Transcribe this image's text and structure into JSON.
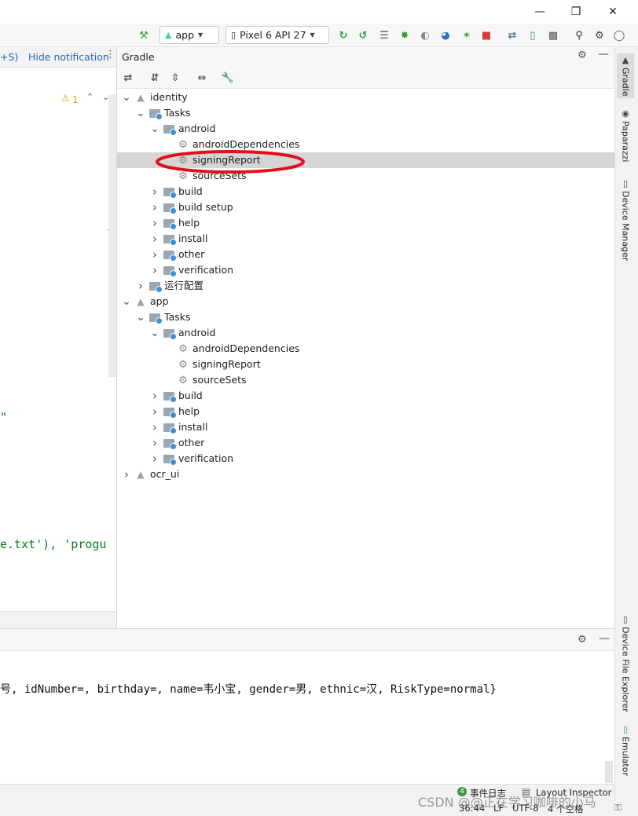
{
  "toolbar": {
    "run_config": "app",
    "device": "Pixel 6 API 27"
  },
  "editor": {
    "shortcut_fragment": "+S)",
    "hide_notification": "Hide notification",
    "warning_count": "1",
    "code_line_1": "\"",
    "code_line_2": "e.txt'), 'progu"
  },
  "gradle": {
    "title": "Gradle",
    "tree": [
      {
        "label": "identity",
        "icon": "elephant-icon",
        "expanded": true
      },
      {
        "label": "Tasks",
        "icon": "folder-icon",
        "expanded": true
      },
      {
        "label": "android",
        "icon": "folder-icon",
        "expanded": true
      },
      {
        "label": "androidDependencies",
        "icon": "gear-icon"
      },
      {
        "label": "signingReport",
        "icon": "gear-icon",
        "selected": true
      },
      {
        "label": "sourceSets",
        "icon": "gear-icon"
      },
      {
        "label": "build",
        "icon": "folder-icon",
        "expanded": false
      },
      {
        "label": "build setup",
        "icon": "folder-icon",
        "expanded": false
      },
      {
        "label": "help",
        "icon": "folder-icon",
        "expanded": false
      },
      {
        "label": "install",
        "icon": "folder-icon",
        "expanded": false
      },
      {
        "label": "other",
        "icon": "folder-icon",
        "expanded": false
      },
      {
        "label": "verification",
        "icon": "folder-icon",
        "expanded": false
      },
      {
        "label": "运行配置",
        "icon": "folder-icon",
        "expanded": false
      },
      {
        "label": "app",
        "icon": "elephant-icon",
        "expanded": true
      },
      {
        "label": "Tasks",
        "icon": "folder-icon",
        "expanded": true
      },
      {
        "label": "android",
        "icon": "folder-icon",
        "expanded": true
      },
      {
        "label": "androidDependencies",
        "icon": "gear-icon"
      },
      {
        "label": "signingReport",
        "icon": "gear-icon"
      },
      {
        "label": "sourceSets",
        "icon": "gear-icon"
      },
      {
        "label": "build",
        "icon": "folder-icon",
        "expanded": false
      },
      {
        "label": "help",
        "icon": "folder-icon",
        "expanded": false
      },
      {
        "label": "install",
        "icon": "folder-icon",
        "expanded": false
      },
      {
        "label": "other",
        "icon": "folder-icon",
        "expanded": false
      },
      {
        "label": "verification",
        "icon": "folder-icon",
        "expanded": false
      },
      {
        "label": "ocr_ui",
        "icon": "elephant-icon",
        "expanded": false
      }
    ]
  },
  "right_tabs": [
    "Gradle",
    "Paparazzi",
    "Device Manager",
    "Device File Explorer",
    "Emulator"
  ],
  "run_panel": {
    "log_line": "号, idNumber=, birthday=, name=韦小宝, gender=男, ethnic=汉, RiskType=normal}"
  },
  "status": {
    "event_log_count": "4",
    "event_log": "事件日志",
    "layout_inspector": "Layout Inspector",
    "position": "36:44",
    "line_sep": "LF",
    "encoding": "UTF-8",
    "indent": "4 个空格"
  },
  "watermark": "CSDN @@正在学习咖啡的小马",
  "colors": {
    "selection": "#d5d5d5",
    "annotation": "#e0101e",
    "string_green": "#0b7a1e",
    "link_blue": "#2b5eb8"
  }
}
